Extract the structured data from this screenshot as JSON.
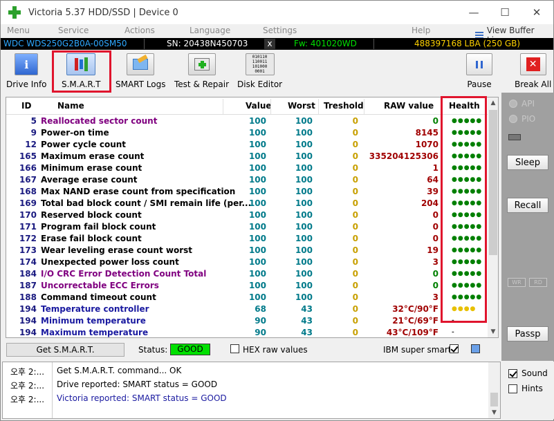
{
  "window": {
    "title": "Victoria 5.37 HDD/SSD | Device 0",
    "minimize": "—",
    "maximize": "☐",
    "close": "✕"
  },
  "menu": [
    "Menu",
    "Service",
    "Actions",
    "Language",
    "Settings",
    "Help"
  ],
  "view_buffer_live": "View Buffer Live",
  "infobar": {
    "model": "WDC  WDS250G2B0A-00SM50",
    "serial": "SN: 20438N450703",
    "close": "x",
    "firmware": "Fw: 401020WD",
    "lba": "488397168 LBA (250 GB)"
  },
  "toolbar": {
    "drive_info": "Drive Info",
    "smart": "S.M.A.R.T",
    "smart_logs": "SMART Logs",
    "test_repair": "Test & Repair",
    "disk_editor": "Disk Editor",
    "pause": "Pause",
    "break_all": "Break All"
  },
  "table": {
    "headers": {
      "id": "ID",
      "name": "Name",
      "value": "Value",
      "worst": "Worst",
      "threshold": "Treshold",
      "raw": "RAW value",
      "health": "Health"
    },
    "rows": [
      {
        "id": "5",
        "name": "Reallocated sector count",
        "value": "100",
        "worst": "100",
        "threshold": "0",
        "raw": "0",
        "health": "●●●●●",
        "name_color": "#800080",
        "raw_color": "#008000",
        "health_color": "#008000"
      },
      {
        "id": "9",
        "name": "Power-on time",
        "value": "100",
        "worst": "100",
        "threshold": "0",
        "raw": "8145",
        "health": "●●●●●",
        "name_color": "#000000",
        "raw_color": "#a00000",
        "health_color": "#008000"
      },
      {
        "id": "12",
        "name": "Power cycle count",
        "value": "100",
        "worst": "100",
        "threshold": "0",
        "raw": "1070",
        "health": "●●●●●",
        "name_color": "#000000",
        "raw_color": "#a00000",
        "health_color": "#008000"
      },
      {
        "id": "165",
        "name": "Maximum erase count",
        "value": "100",
        "worst": "100",
        "threshold": "0",
        "raw": "335204125306",
        "health": "●●●●●",
        "name_color": "#000000",
        "raw_color": "#a00000",
        "health_color": "#008000"
      },
      {
        "id": "166",
        "name": "Minimum erase count",
        "value": "100",
        "worst": "100",
        "threshold": "0",
        "raw": "1",
        "health": "●●●●●",
        "name_color": "#000000",
        "raw_color": "#a00000",
        "health_color": "#008000"
      },
      {
        "id": "167",
        "name": "Average erase count",
        "value": "100",
        "worst": "100",
        "threshold": "0",
        "raw": "64",
        "health": "●●●●●",
        "name_color": "#000000",
        "raw_color": "#a00000",
        "health_color": "#008000"
      },
      {
        "id": "168",
        "name": "Max NAND erase count from specification",
        "value": "100",
        "worst": "100",
        "threshold": "0",
        "raw": "39",
        "health": "●●●●●",
        "name_color": "#000000",
        "raw_color": "#a00000",
        "health_color": "#008000"
      },
      {
        "id": "169",
        "name": "Total bad block count / SMI remain life (per...",
        "value": "100",
        "worst": "100",
        "threshold": "0",
        "raw": "204",
        "health": "●●●●●",
        "name_color": "#000000",
        "raw_color": "#a00000",
        "health_color": "#008000"
      },
      {
        "id": "170",
        "name": "Reserved block count",
        "value": "100",
        "worst": "100",
        "threshold": "0",
        "raw": "0",
        "health": "●●●●●",
        "name_color": "#000000",
        "raw_color": "#a00000",
        "health_color": "#008000"
      },
      {
        "id": "171",
        "name": "Program fail block count",
        "value": "100",
        "worst": "100",
        "threshold": "0",
        "raw": "0",
        "health": "●●●●●",
        "name_color": "#000000",
        "raw_color": "#a00000",
        "health_color": "#008000"
      },
      {
        "id": "172",
        "name": "Erase fail block count",
        "value": "100",
        "worst": "100",
        "threshold": "0",
        "raw": "0",
        "health": "●●●●●",
        "name_color": "#000000",
        "raw_color": "#a00000",
        "health_color": "#008000"
      },
      {
        "id": "173",
        "name": "Wear leveling erase count worst",
        "value": "100",
        "worst": "100",
        "threshold": "0",
        "raw": "19",
        "health": "●●●●●",
        "name_color": "#000000",
        "raw_color": "#a00000",
        "health_color": "#008000"
      },
      {
        "id": "174",
        "name": "Unexpected power loss count",
        "value": "100",
        "worst": "100",
        "threshold": "0",
        "raw": "3",
        "health": "●●●●●",
        "name_color": "#000000",
        "raw_color": "#a00000",
        "health_color": "#008000"
      },
      {
        "id": "184",
        "name": "I/O CRC Error Detection Count Total",
        "value": "100",
        "worst": "100",
        "threshold": "0",
        "raw": "0",
        "health": "●●●●●",
        "name_color": "#800080",
        "raw_color": "#008000",
        "health_color": "#008000"
      },
      {
        "id": "187",
        "name": "Uncorrectable ECC Errors",
        "value": "100",
        "worst": "100",
        "threshold": "0",
        "raw": "0",
        "health": "●●●●●",
        "name_color": "#800080",
        "raw_color": "#008000",
        "health_color": "#008000"
      },
      {
        "id": "188",
        "name": "Command timeout count",
        "value": "100",
        "worst": "100",
        "threshold": "0",
        "raw": "3",
        "health": "●●●●●",
        "name_color": "#000000",
        "raw_color": "#a00000",
        "health_color": "#008000"
      },
      {
        "id": "194",
        "name": "Temperature controller",
        "value": "68",
        "worst": "43",
        "threshold": "0",
        "raw": "32°C/90°F",
        "health": "●●●●",
        "name_color": "#1a1aa0",
        "raw_color": "#a00000",
        "health_color": "#e8c000"
      },
      {
        "id": "194",
        "name": "Minimum temperature",
        "value": "90",
        "worst": "43",
        "threshold": "0",
        "raw": "21°C/69°F",
        "health": "-",
        "name_color": "#1a1aa0",
        "raw_color": "#a00000",
        "health_color": "#333333"
      },
      {
        "id": "194",
        "name": "Maximum temperature",
        "value": "90",
        "worst": "43",
        "threshold": "0",
        "raw": "43°C/109°F",
        "health": "-",
        "name_color": "#1a1aa0",
        "raw_color": "#a00000",
        "health_color": "#333333"
      }
    ]
  },
  "side": {
    "api": "API",
    "pio": "PIO",
    "sleep": "Sleep",
    "recall": "Recall",
    "wr": "WR",
    "rd": "RD",
    "passp": "Passp"
  },
  "status": {
    "get_smart": "Get S.M.A.R.T.",
    "status_label": "Status:",
    "status_value": "GOOD",
    "hex_raw": "HEX raw values",
    "ibm_super_smart": "IBM super smart:"
  },
  "log": [
    {
      "time": "오후 2:...",
      "text": "Get S.M.A.R.T. command... OK",
      "color": "#000000"
    },
    {
      "time": "오후 2:...",
      "text": "Drive reported: SMART status = GOOD",
      "color": "#000000"
    },
    {
      "time": "오후 2:...",
      "text": "Victoria reported: SMART status = GOOD",
      "color": "#1a1aa0"
    }
  ],
  "bottom": {
    "sound": "Sound",
    "hints": "Hints"
  },
  "colors": {
    "status_good_bg": "#00e000",
    "highlight_red": "#e0142d",
    "value_teal": "#007a8a"
  }
}
